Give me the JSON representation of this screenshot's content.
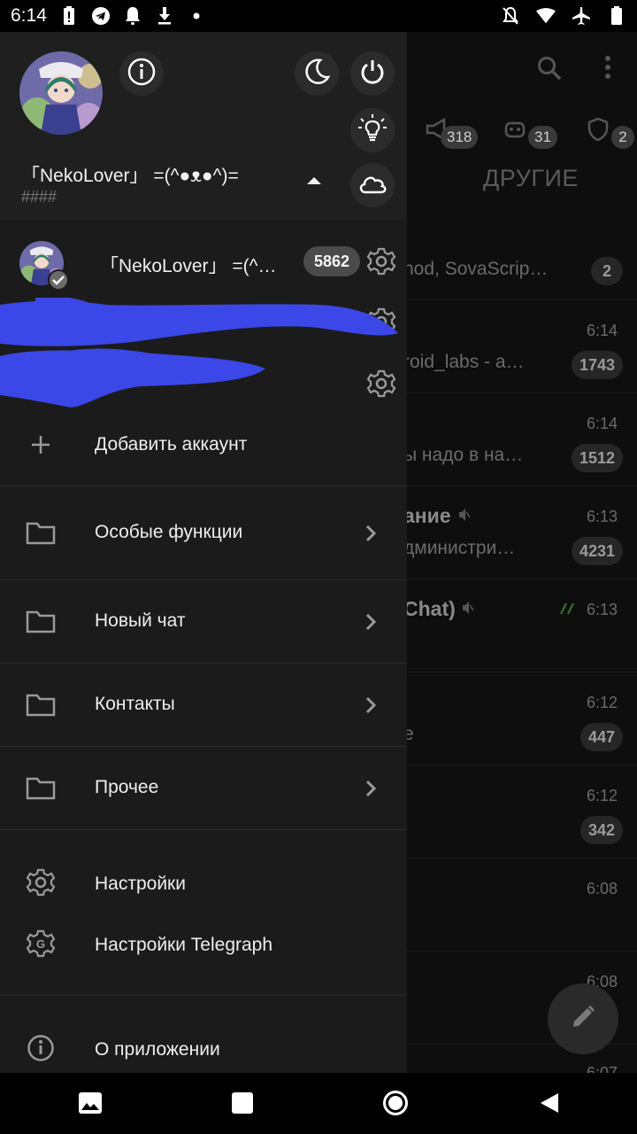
{
  "status_bar": {
    "time": "6:14",
    "left_icons": [
      "battery-alert-icon",
      "telegram-icon",
      "notification-bell-icon",
      "download-icon",
      "dot-icon"
    ],
    "right_icons": [
      "notifications-off-icon",
      "wifi-icon",
      "airplane-icon",
      "battery-icon"
    ]
  },
  "background": {
    "tab_badges": [
      "318",
      "31",
      "2"
    ],
    "tab_title": "ДРУГИЕ",
    "rows": [
      {
        "message": "nod, SovaScrip…",
        "count": "2"
      },
      {
        "time": "6:14",
        "message": "roid_labs  - a…",
        "count": "1743"
      },
      {
        "time": "6:14",
        "message": "ы надо в на…",
        "count": "1512"
      },
      {
        "time": "6:13",
        "name": "ание",
        "message": "дминистри…",
        "count": "4231"
      },
      {
        "time": "6:13",
        "name": "Chat)"
      },
      {
        "time": "6:12",
        "message": "e",
        "count": "447"
      },
      {
        "time": "6:12",
        "count": "342"
      },
      {
        "time": "6:08"
      },
      {
        "time": "6:08"
      },
      {
        "time": "6:07"
      }
    ]
  },
  "drawer": {
    "header": {
      "name": "「NekoLover」 =(^●ᴥ●^)=",
      "subtitle": "####"
    },
    "accounts": [
      {
        "name": "「NekoLover」 =(^●ᴥ●^)=",
        "count": "5862"
      }
    ],
    "add_account": "Добавить аккаунт",
    "menu": [
      {
        "label": "Особые функции"
      },
      {
        "label": "Новый чат"
      },
      {
        "label": "Контакты"
      },
      {
        "label": "Прочее"
      }
    ],
    "settings": "Настройки",
    "telegraph_settings": "Настройки Telegraph",
    "about": "О приложении"
  },
  "colors": {
    "drawer_bg": "#1b1b1b",
    "header_bg": "#1f1f1f",
    "scribble": "#3b47e6",
    "badge_bg": "#4b4b4b"
  }
}
